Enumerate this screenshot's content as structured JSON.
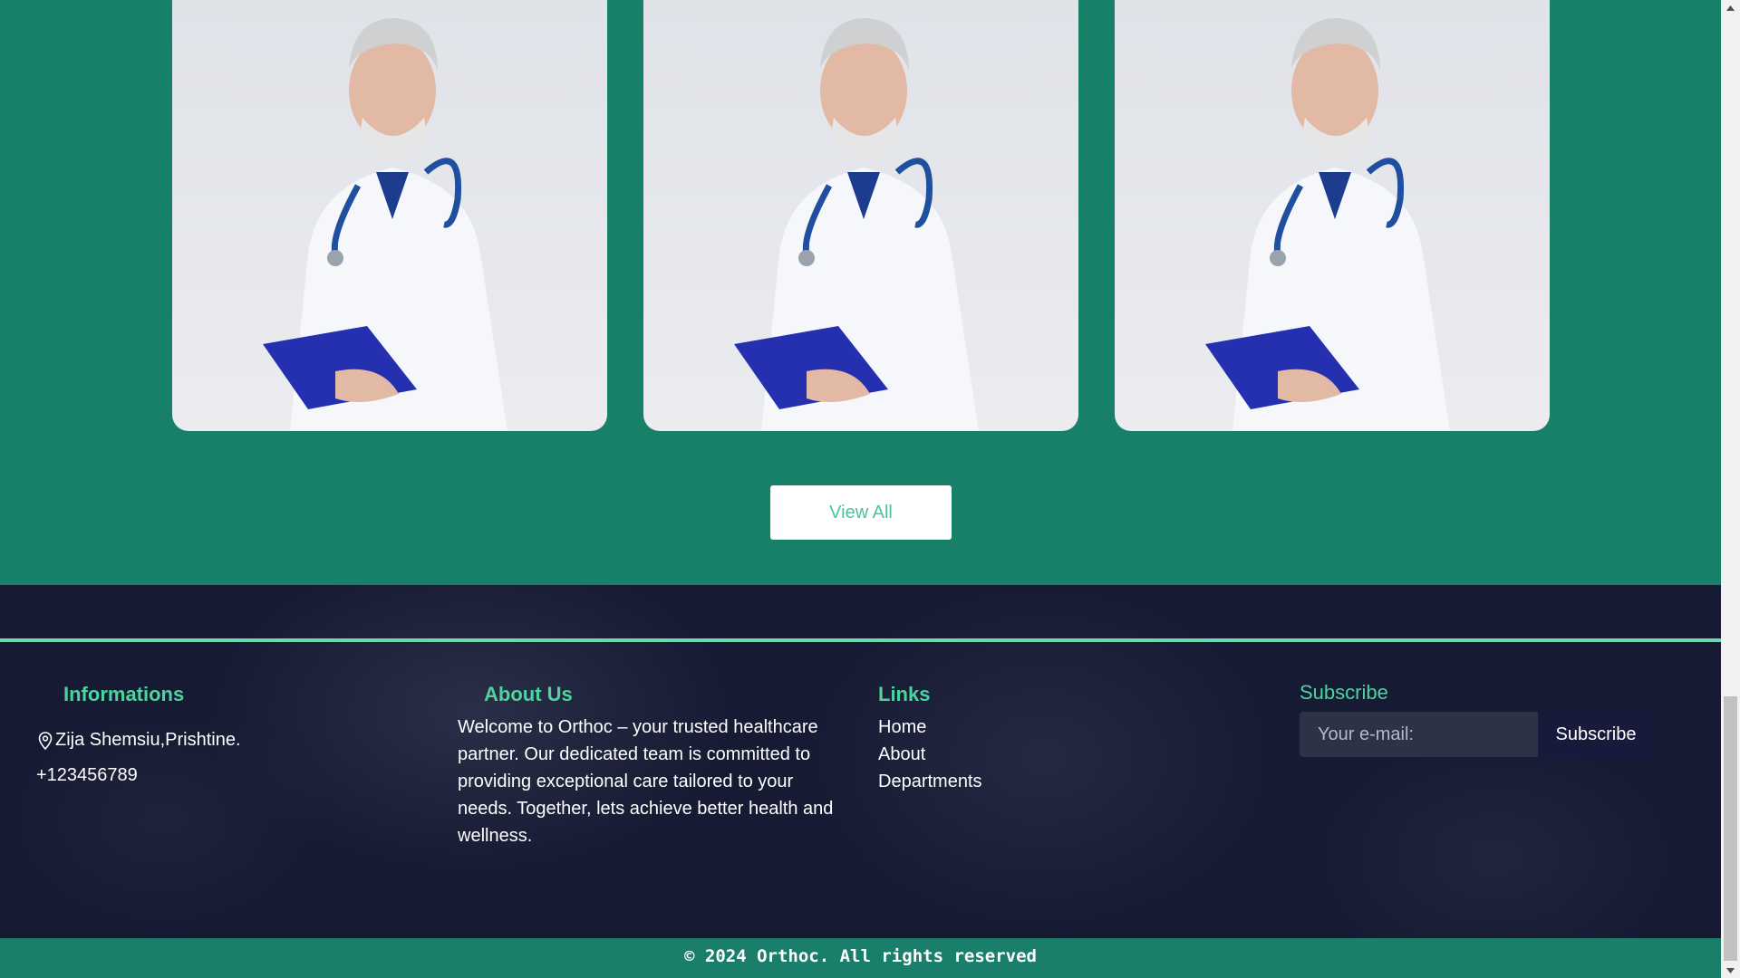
{
  "doctors": {
    "cards": [
      {
        "alt": "doctor-photo"
      },
      {
        "alt": "doctor-photo"
      },
      {
        "alt": "doctor-photo"
      }
    ],
    "view_all_label": "View All"
  },
  "footer": {
    "informations": {
      "title": "Informations",
      "address": "Zija Shemsiu,Prishtine.",
      "phone": "+123456789",
      "location_icon": "map-pin-icon"
    },
    "about": {
      "title": "About Us",
      "text": "Welcome to Orthoc – your trusted healthcare partner. Our dedicated team is committed to providing exceptional care tailored to your needs. Together, lets achieve better health and wellness."
    },
    "links": {
      "title": "Links",
      "items": [
        "Home",
        "About",
        "Departments"
      ]
    },
    "subscribe": {
      "title": "Subscribe",
      "placeholder": "Your e-mail:",
      "button_label": "Subscribe"
    },
    "copyright": "© 2024 Orthoc. All rights reserved"
  },
  "colors": {
    "green": "#188068",
    "accent": "#4cd49f",
    "footer_bg": "#161a33"
  }
}
